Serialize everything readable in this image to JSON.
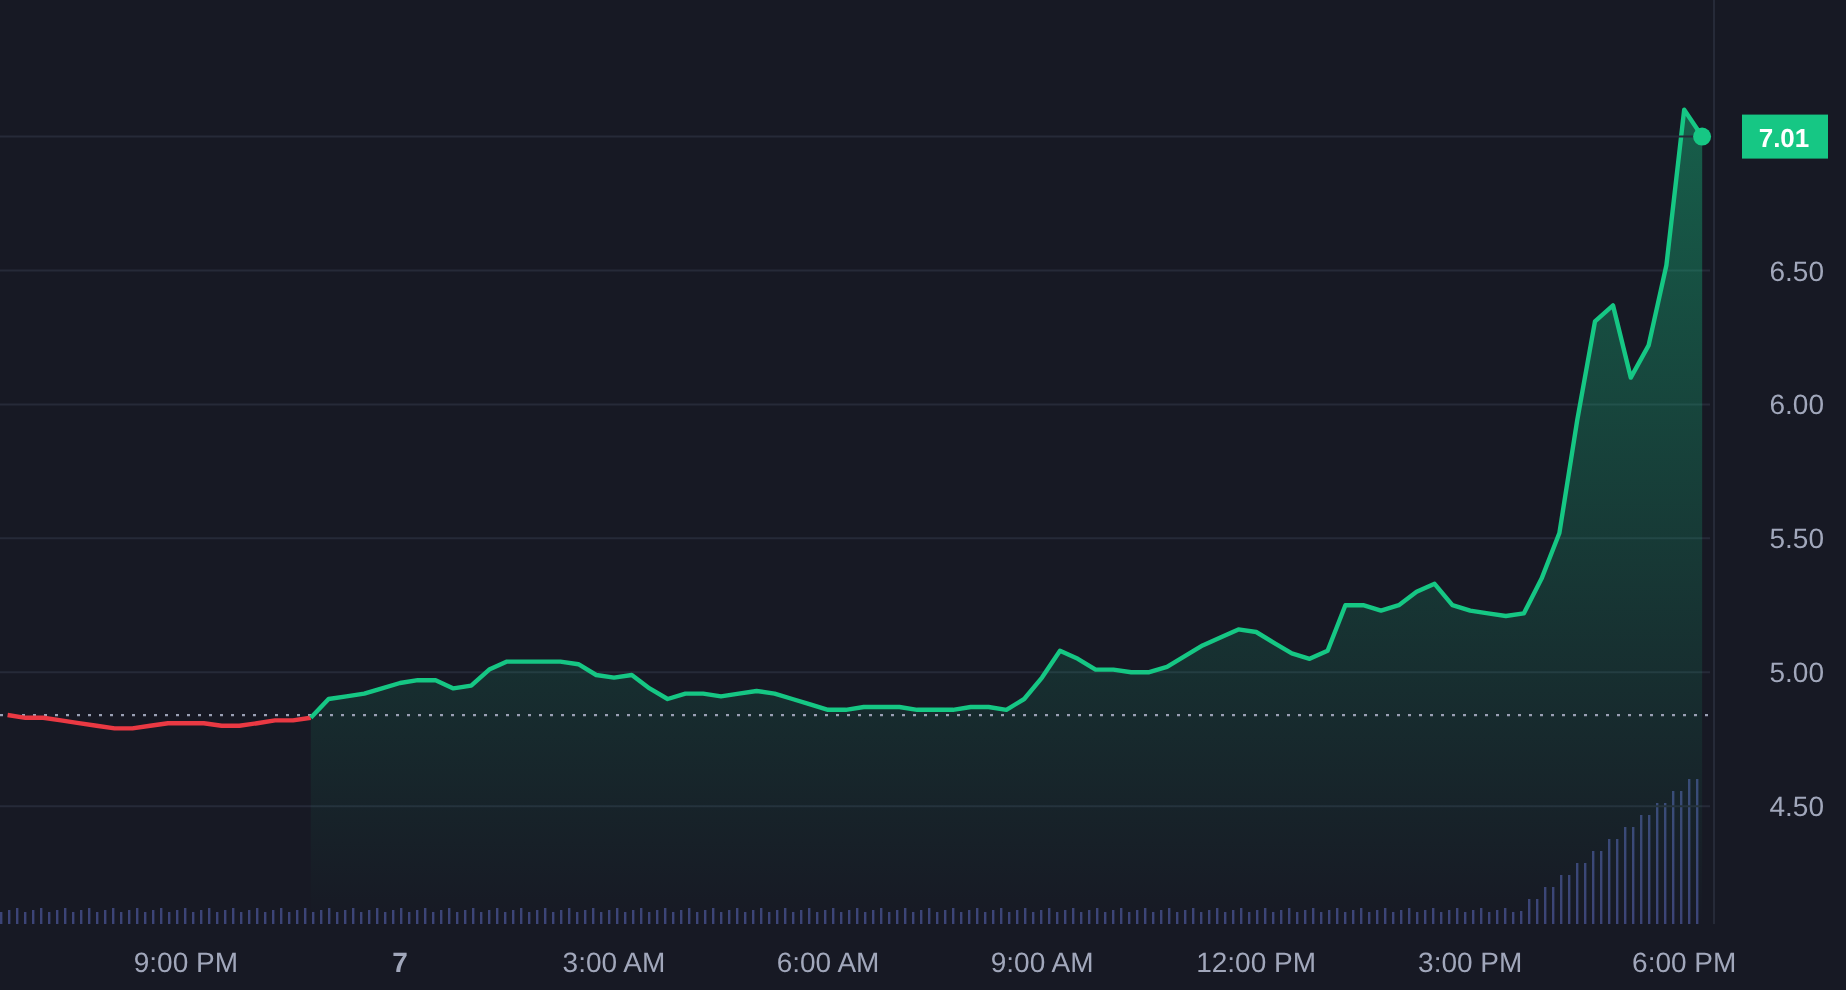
{
  "chart": {
    "chart_data": {
      "type": "area",
      "grid": true,
      "categories": [
        null,
        null,
        null,
        null,
        null,
        null,
        null,
        null,
        null,
        null,
        "9:00 PM",
        null,
        null,
        null,
        null,
        null,
        null,
        null,
        null,
        null,
        null,
        null,
        "7",
        null,
        null,
        null,
        null,
        null,
        null,
        null,
        null,
        null,
        null,
        null,
        "3:00 AM",
        null,
        null,
        null,
        null,
        null,
        null,
        null,
        null,
        null,
        null,
        null,
        "6:00 AM",
        null,
        null,
        null,
        null,
        null,
        null,
        null,
        null,
        null,
        null,
        null,
        "9:00 AM",
        null,
        null,
        null,
        null,
        null,
        null,
        null,
        null,
        null,
        null,
        null,
        "12:00 PM",
        null,
        null,
        null,
        null,
        null,
        null,
        null,
        null,
        null,
        null,
        null,
        "3:00 PM",
        null,
        null,
        null,
        null,
        null,
        null,
        null,
        null,
        null,
        null,
        null,
        "6:00 PM",
        null
      ],
      "series": [
        {
          "type": "line",
          "color": "#ea3943",
          "values": [
            4.84,
            4.83,
            4.83,
            4.82,
            4.81,
            4.8,
            4.79,
            4.79,
            4.8,
            4.81,
            4.81,
            4.81,
            4.8,
            4.8,
            4.81,
            4.82,
            4.82,
            4.83,
            null,
            null,
            null,
            null,
            null,
            null,
            null,
            null,
            null,
            null,
            null,
            null,
            null,
            null,
            null,
            null,
            null,
            null,
            null,
            null,
            null,
            null,
            null,
            null,
            null,
            null,
            null,
            null,
            null,
            null,
            null,
            null,
            null,
            null,
            null,
            null,
            null,
            null,
            null,
            null,
            null,
            null,
            null,
            null,
            null,
            null,
            null,
            null,
            null,
            null,
            null,
            null,
            null,
            null,
            null,
            null,
            null,
            null,
            null,
            null,
            null,
            null,
            null,
            null,
            null,
            null,
            null,
            null,
            null,
            null,
            null,
            null,
            null,
            null,
            null,
            null,
            null,
            null
          ]
        },
        {
          "type": "area",
          "color": "#16c784",
          "values": [
            null,
            null,
            null,
            null,
            null,
            null,
            null,
            null,
            null,
            null,
            null,
            null,
            null,
            null,
            null,
            null,
            null,
            4.83,
            4.9,
            4.91,
            4.92,
            4.94,
            4.96,
            4.97,
            4.97,
            4.94,
            4.95,
            5.01,
            5.04,
            5.04,
            5.04,
            5.04,
            5.03,
            4.99,
            4.98,
            4.99,
            4.94,
            4.9,
            4.92,
            4.92,
            4.91,
            4.92,
            4.93,
            4.92,
            4.9,
            4.88,
            4.86,
            4.86,
            4.87,
            4.87,
            4.87,
            4.86,
            4.86,
            4.86,
            4.87,
            4.87,
            4.86,
            4.9,
            4.98,
            5.08,
            5.05,
            5.01,
            5.01,
            5.0,
            5.0,
            5.02,
            5.06,
            5.1,
            5.13,
            5.16,
            5.15,
            5.11,
            5.07,
            5.05,
            5.08,
            5.25,
            5.25,
            5.23,
            5.25,
            5.3,
            5.33,
            5.25,
            5.23,
            5.22,
            5.21,
            5.22,
            5.35,
            5.52,
            5.94,
            6.31,
            6.37,
            6.1,
            6.22,
            6.52,
            7.1,
            7.0
          ]
        }
      ],
      "ylim": [
        4.06,
        7.51
      ],
      "yticks": [
        {
          "value": 4.5,
          "label": "4.50"
        },
        {
          "value": 5,
          "label": "5.00"
        },
        {
          "value": 5.5,
          "label": "5.50"
        },
        {
          "value": 6,
          "label": "6.00"
        },
        {
          "value": 6.5,
          "label": "6.50"
        }
      ],
      "ref_lines": [
        {
          "axis": "y",
          "value": 4.84
        }
      ],
      "annotations": [
        "7.01"
      ]
    }
  }
}
